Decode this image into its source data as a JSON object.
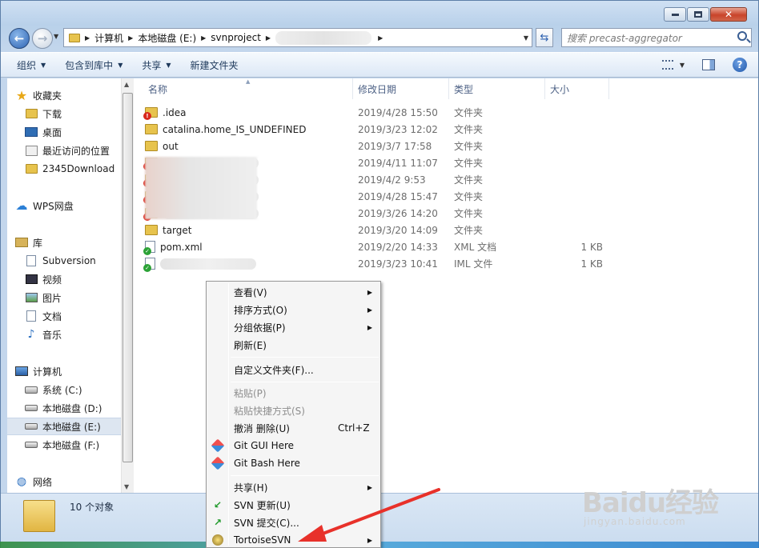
{
  "window": {
    "minimize_icon": "minimize-icon",
    "maximize_icon": "maximize-icon",
    "close_icon": "close-icon"
  },
  "address_bar": {
    "crumbs": [
      "计算机",
      "本地磁盘 (E:)",
      "svnproject"
    ],
    "search_placeholder": "搜索 precast-aggregator"
  },
  "toolbar": {
    "organize": "组织",
    "include_in_library": "包含到库中",
    "share": "共享",
    "new_folder": "新建文件夹"
  },
  "sidebar": {
    "items": [
      {
        "label": "收藏夹",
        "icon": "star-icon"
      },
      {
        "label": "下载",
        "icon": "download-folder-icon"
      },
      {
        "label": "桌面",
        "icon": "desktop-icon"
      },
      {
        "label": "最近访问的位置",
        "icon": "recent-places-icon"
      },
      {
        "label": "2345Download",
        "icon": "folder-icon"
      },
      {
        "label": "WPS网盘",
        "icon": "cloud-icon"
      },
      {
        "label": "库",
        "icon": "library-icon"
      },
      {
        "label": "Subversion",
        "icon": "document-icon"
      },
      {
        "label": "视频",
        "icon": "video-icon"
      },
      {
        "label": "图片",
        "icon": "pictures-icon"
      },
      {
        "label": "文档",
        "icon": "documents-icon"
      },
      {
        "label": "音乐",
        "icon": "music-icon"
      },
      {
        "label": "计算机",
        "icon": "computer-icon"
      },
      {
        "label": "系统 (C:)",
        "icon": "system-drive-icon"
      },
      {
        "label": "本地磁盘 (D:)",
        "icon": "drive-icon"
      },
      {
        "label": "本地磁盘 (E:)",
        "icon": "drive-icon"
      },
      {
        "label": "本地磁盘 (F:)",
        "icon": "drive-icon"
      },
      {
        "label": "网络",
        "icon": "network-icon"
      }
    ],
    "selected": "本地磁盘 (E:)"
  },
  "columns": {
    "name": "名称",
    "modified": "修改日期",
    "type": "类型",
    "size": "大小"
  },
  "files": [
    {
      "name": ".idea",
      "date": "2019/4/28 15:50",
      "type": "文件夹",
      "size": "",
      "kind": "folder",
      "badge": "red"
    },
    {
      "name": "catalina.home_IS_UNDEFINED",
      "date": "2019/3/23 12:02",
      "type": "文件夹",
      "size": "",
      "kind": "folder",
      "badge": ""
    },
    {
      "name": "out",
      "date": "2019/3/7 17:58",
      "type": "文件夹",
      "size": "",
      "kind": "folder",
      "badge": ""
    },
    {
      "name": "",
      "date": "2019/4/11 11:07",
      "type": "文件夹",
      "size": "",
      "kind": "folder",
      "badge": "red",
      "blurred": true
    },
    {
      "name": "",
      "date": "2019/4/2 9:53",
      "type": "文件夹",
      "size": "",
      "kind": "folder",
      "badge": "red",
      "blurred": true
    },
    {
      "name": "",
      "date": "2019/4/28 15:47",
      "type": "文件夹",
      "size": "",
      "kind": "folder",
      "badge": "red",
      "blurred": true
    },
    {
      "name": "",
      "date": "2019/3/26 14:20",
      "type": "文件夹",
      "size": "",
      "kind": "folder",
      "badge": "red",
      "blurred": true
    },
    {
      "name": "target",
      "date": "2019/3/20 14:09",
      "type": "文件夹",
      "size": "",
      "kind": "folder",
      "badge": ""
    },
    {
      "name": "pom.xml",
      "date": "2019/2/20 14:33",
      "type": "XML 文档",
      "size": "1 KB",
      "kind": "xml",
      "badge": "green"
    },
    {
      "name": "",
      "date": "2019/3/23 10:41",
      "type": "IML 文件",
      "size": "1 KB",
      "kind": "iml",
      "badge": "green",
      "blurred": true
    }
  ],
  "status": {
    "count": "10 个对象"
  },
  "context_menu": {
    "view": "查看(V)",
    "sort_by": "排序方式(O)",
    "group_by": "分组依据(P)",
    "refresh": "刷新(E)",
    "customize": "自定义文件夹(F)...",
    "paste": "粘贴(P)",
    "paste_shortcut": "粘贴快捷方式(S)",
    "undo_delete": "撤消 删除(U)",
    "undo_shortcut": "Ctrl+Z",
    "git_gui": "Git GUI Here",
    "git_bash": "Git Bash Here",
    "share": "共享(H)",
    "svn_update": "SVN 更新(U)",
    "svn_commit": "SVN 提交(C)...",
    "tortoise": "TortoiseSVN"
  },
  "watermark": {
    "brand": "Baidu经验",
    "url": "jingyan.baidu.com"
  },
  "colors": {
    "accent": "#2d63b3",
    "annotation_arrow": "#e8312a",
    "selected_bg": "#dde6f1"
  }
}
